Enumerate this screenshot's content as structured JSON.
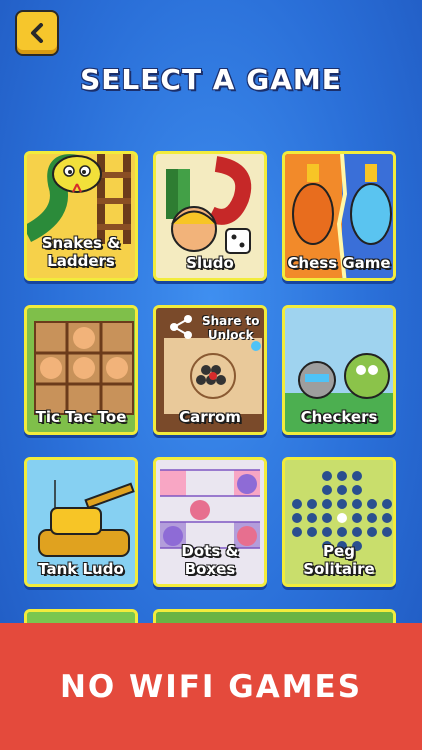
{
  "header": {
    "title": "SELECT A GAME",
    "back_icon": "chevron-left-icon"
  },
  "games": [
    {
      "label_line1": "Snakes &",
      "label_line2": "Ladders",
      "bg": "#f3c63b"
    },
    {
      "label_line1": "Sludo",
      "label_line2": "",
      "bg": "#f6e9a8"
    },
    {
      "label_line1": "Chess Game",
      "label_line2": "",
      "bg": "#8a3fb8"
    },
    {
      "label_line1": "Tic Tac Toe",
      "label_line2": "",
      "bg": "#c89b5a"
    },
    {
      "label_line1": "Carrom",
      "label_line2": "",
      "bg": "#d9b58a",
      "badge": "Share to Unlock",
      "badge_line1": "Share to",
      "badge_line2": "Unlock",
      "badge_icon": "share-icon"
    },
    {
      "label_line1": "Checkers",
      "label_line2": "",
      "bg": "#8fc7e8"
    },
    {
      "label_line1": "Tank Ludo",
      "label_line2": "",
      "bg": "#7cc6ef"
    },
    {
      "label_line1": "Dots & Boxes",
      "label_line2": "",
      "bg": "#e9e3ef"
    },
    {
      "label_line1": "Peg Solitaire",
      "label_line2": "",
      "bg": "#c9de6c"
    }
  ],
  "banner": {
    "text": "NO WIFI GAMES",
    "color": "#e44a3c"
  },
  "colors": {
    "card_border": "#f2ec3c",
    "back_button": "#f6c62c"
  }
}
